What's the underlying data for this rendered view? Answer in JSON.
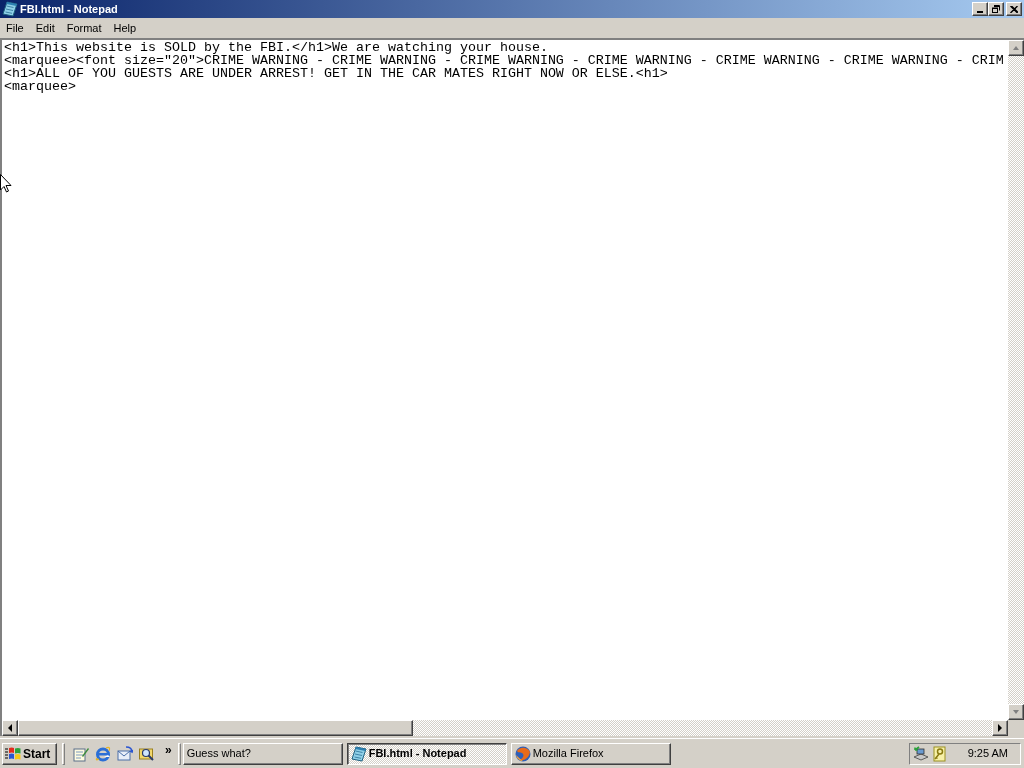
{
  "window": {
    "title": "FBI.html - Notepad"
  },
  "menu": [
    "File",
    "Edit",
    "Format",
    "Help"
  ],
  "editor": {
    "lines": [
      "<h1>This website is SOLD by the FBI.</h1>We are watching your house.",
      "<marquee><font size=\"20\">CRIME WARNING - CRIME WARNING - CRIME WARNING - CRIME WARNING - CRIME WARNING - CRIME WARNING - CRIM",
      "<h1>ALL OF YOU GUESTS ARE UNDER ARREST! GET IN THE CAR MATES RIGHT NOW OR ELSE.<h1>",
      "<marquee>"
    ]
  },
  "taskbar": {
    "start": "Start",
    "quick_launch_more": "»",
    "tasks": [
      {
        "label": "Guess what?",
        "kind": "plain",
        "selected": false
      },
      {
        "label": "FBI.html - Notepad",
        "kind": "notepad",
        "selected": true
      },
      {
        "label": "Mozilla Firefox",
        "kind": "browser",
        "selected": false
      }
    ],
    "clock": "9:25 AM"
  }
}
